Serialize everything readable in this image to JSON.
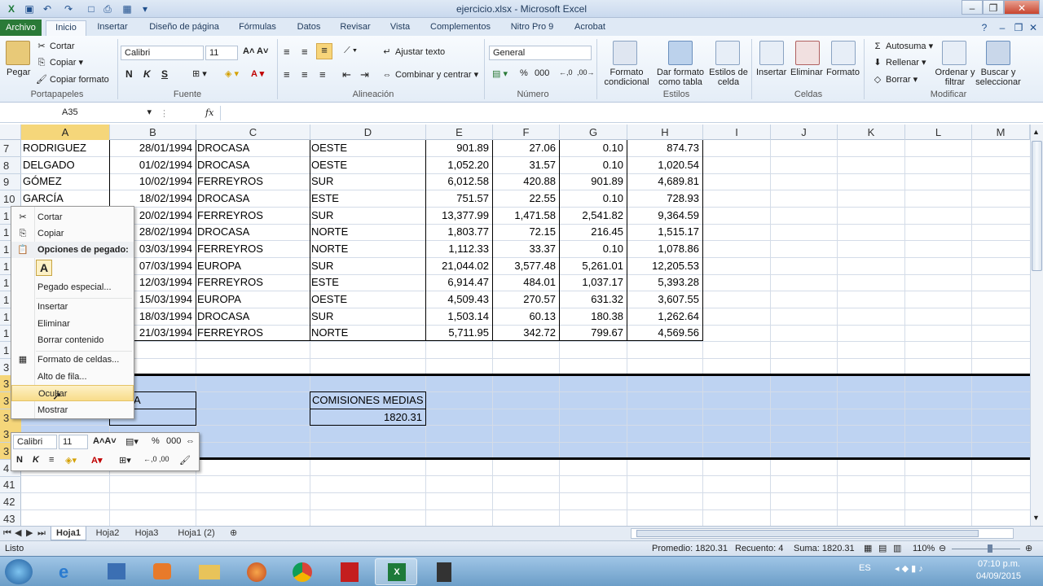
{
  "window": {
    "title": "ejercicio.xlsx - Microsoft Excel"
  },
  "tabs": [
    "Archivo",
    "Inicio",
    "Insertar",
    "Diseño de página",
    "Fórmulas",
    "Datos",
    "Revisar",
    "Vista",
    "Complementos",
    "Nitro Pro 9",
    "Acrobat"
  ],
  "ribbon": {
    "clipboard": {
      "paste": "Pegar",
      "cut": "Cortar",
      "copy": "Copiar",
      "format_painter": "Copiar formato",
      "label": "Portapapeles"
    },
    "font": {
      "name": "Calibri",
      "size": "11",
      "label": "Fuente",
      "bold": "N",
      "italic": "K",
      "underline": "S"
    },
    "alignment": {
      "wrap": "Ajustar texto",
      "merge": "Combinar y centrar",
      "label": "Alineación"
    },
    "number": {
      "format": "General",
      "percent": "%",
      "thousands": "000",
      "label": "Número"
    },
    "styles": {
      "conditional": "Formato condicional",
      "as_table": "Dar formato como tabla",
      "cell_styles": "Estilos de celda",
      "label": "Estilos"
    },
    "cells": {
      "insert": "Insertar",
      "delete": "Eliminar",
      "format": "Formato",
      "label": "Celdas"
    },
    "editing": {
      "autosum": "Autosuma",
      "fill": "Rellenar",
      "clear": "Borrar",
      "sort": "Ordenar y filtrar",
      "find": "Buscar y seleccionar",
      "label": "Modificar"
    }
  },
  "formula_bar": {
    "name_box": "A35",
    "fx": "fx",
    "value": ""
  },
  "columns": [
    "A",
    "B",
    "C",
    "D",
    "E",
    "F",
    "G",
    "H",
    "I",
    "J",
    "K",
    "L",
    "M"
  ],
  "rows_top": [
    {
      "n": "7",
      "a": "RODRIGUEZ",
      "b": "28/01/1994",
      "c": "DROCASA",
      "d": "OESTE",
      "e": "901.89",
      "f": "27.06",
      "g": "0.10",
      "h": "874.73"
    },
    {
      "n": "8",
      "a": "DELGADO",
      "b": "01/02/1994",
      "c": "DROCASA",
      "d": "OESTE",
      "e": "1,052.20",
      "f": "31.57",
      "g": "0.10",
      "h": "1,020.54"
    },
    {
      "n": "9",
      "a": "GÓMEZ",
      "b": "10/02/1994",
      "c": "FERREYROS",
      "d": "SUR",
      "e": "6,012.58",
      "f": "420.88",
      "g": "901.89",
      "h": "4,689.81"
    },
    {
      "n": "10",
      "a": "GARCÍA",
      "b": "18/02/1994",
      "c": "DROCASA",
      "d": "ESTE",
      "e": "751.57",
      "f": "22.55",
      "g": "0.10",
      "h": "728.93"
    }
  ],
  "rows_hidden_by_menu": [
    {
      "n": "1",
      "b": "20/02/1994",
      "c": "FERREYROS",
      "d": "SUR",
      "e": "13,377.99",
      "f": "1,471.58",
      "g": "2,541.82",
      "h": "9,364.59"
    },
    {
      "n": "1",
      "b": "28/02/1994",
      "c": "DROCASA",
      "d": "NORTE",
      "e": "1,803.77",
      "f": "72.15",
      "g": "216.45",
      "h": "1,515.17"
    },
    {
      "n": "1",
      "b": "03/03/1994",
      "c": "FERREYROS",
      "d": "NORTE",
      "e": "1,112.33",
      "f": "33.37",
      "g": "0.10",
      "h": "1,078.86"
    },
    {
      "n": "1",
      "b": "07/03/1994",
      "c": "EUROPA",
      "d": "SUR",
      "e": "21,044.02",
      "f": "3,577.48",
      "g": "5,261.01",
      "h": "12,205.53"
    },
    {
      "n": "1",
      "b": "12/03/1994",
      "c": "FERREYROS",
      "d": "ESTE",
      "e": "6,914.47",
      "f": "484.01",
      "g": "1,037.17",
      "h": "5,393.28"
    },
    {
      "n": "1",
      "b": "15/03/1994",
      "c": "EUROPA",
      "d": "OESTE",
      "e": "4,509.43",
      "f": "270.57",
      "g": "631.32",
      "h": "3,607.55"
    },
    {
      "n": "1",
      "b": "18/03/1994",
      "c": "DROCASA",
      "d": "SUR",
      "e": "1,503.14",
      "f": "60.13",
      "g": "180.38",
      "h": "1,262.64"
    },
    {
      "n": "1",
      "b": "21/03/1994",
      "c": "FERREYROS",
      "d": "NORTE",
      "e": "5,711.95",
      "f": "342.72",
      "g": "799.67",
      "h": "4,569.56"
    }
  ],
  "row_numbers_lower": [
    "1",
    "3",
    "3",
    "3",
    "3",
    "3",
    "3",
    "4",
    "41",
    "42",
    "43"
  ],
  "summary": {
    "a_label": "A",
    "a_value": "",
    "d_label": "COMISIONES MEDIAS",
    "d_value": "1820.31"
  },
  "context_menu": {
    "cut": "Cortar",
    "copy": "Copiar",
    "paste_header": "Opciones de pegado:",
    "paste_a": "A",
    "paste_special": "Pegado especial...",
    "insert": "Insertar",
    "delete": "Eliminar",
    "clear": "Borrar contenido",
    "format_cells": "Formato de celdas...",
    "row_height": "Alto de fila...",
    "hide": "Ocultar",
    "unhide": "Mostrar"
  },
  "mini_toolbar": {
    "font": "Calibri",
    "size": "11",
    "percent": "%",
    "thousands": "000",
    "bold": "N",
    "italic": "K"
  },
  "sheets": [
    "Hoja1",
    "Hoja2",
    "Hoja3",
    "Hoja1 (2)"
  ],
  "status": {
    "ready": "Listo",
    "average": "Promedio: 1820.31",
    "count": "Recuento: 4",
    "sum": "Suma: 1820.31",
    "zoom": "110%"
  },
  "taskbar": {
    "lang": "ES",
    "time": "07:10 p.m.",
    "date": "04/09/2015"
  },
  "colors": {
    "ribbon_bg": "#e4edf7",
    "file_tab": "#2a7a37",
    "selection": "#bed3f2",
    "header_sel": "#f5d67a"
  }
}
